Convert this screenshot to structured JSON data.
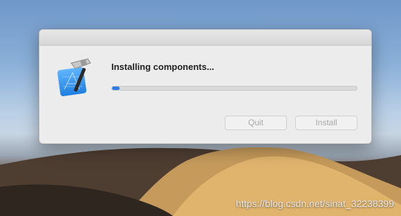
{
  "dialog": {
    "message": "Installing components...",
    "progress": 0.03,
    "app_icon": "xcode-icon"
  },
  "buttons": {
    "quit_label": "Quit",
    "install_label": "Install"
  },
  "watermark": "https://blog.csdn.net/sinat_32238399",
  "colors": {
    "progress_accent": "#2f7ae5",
    "dialog_background": "#ececec"
  }
}
